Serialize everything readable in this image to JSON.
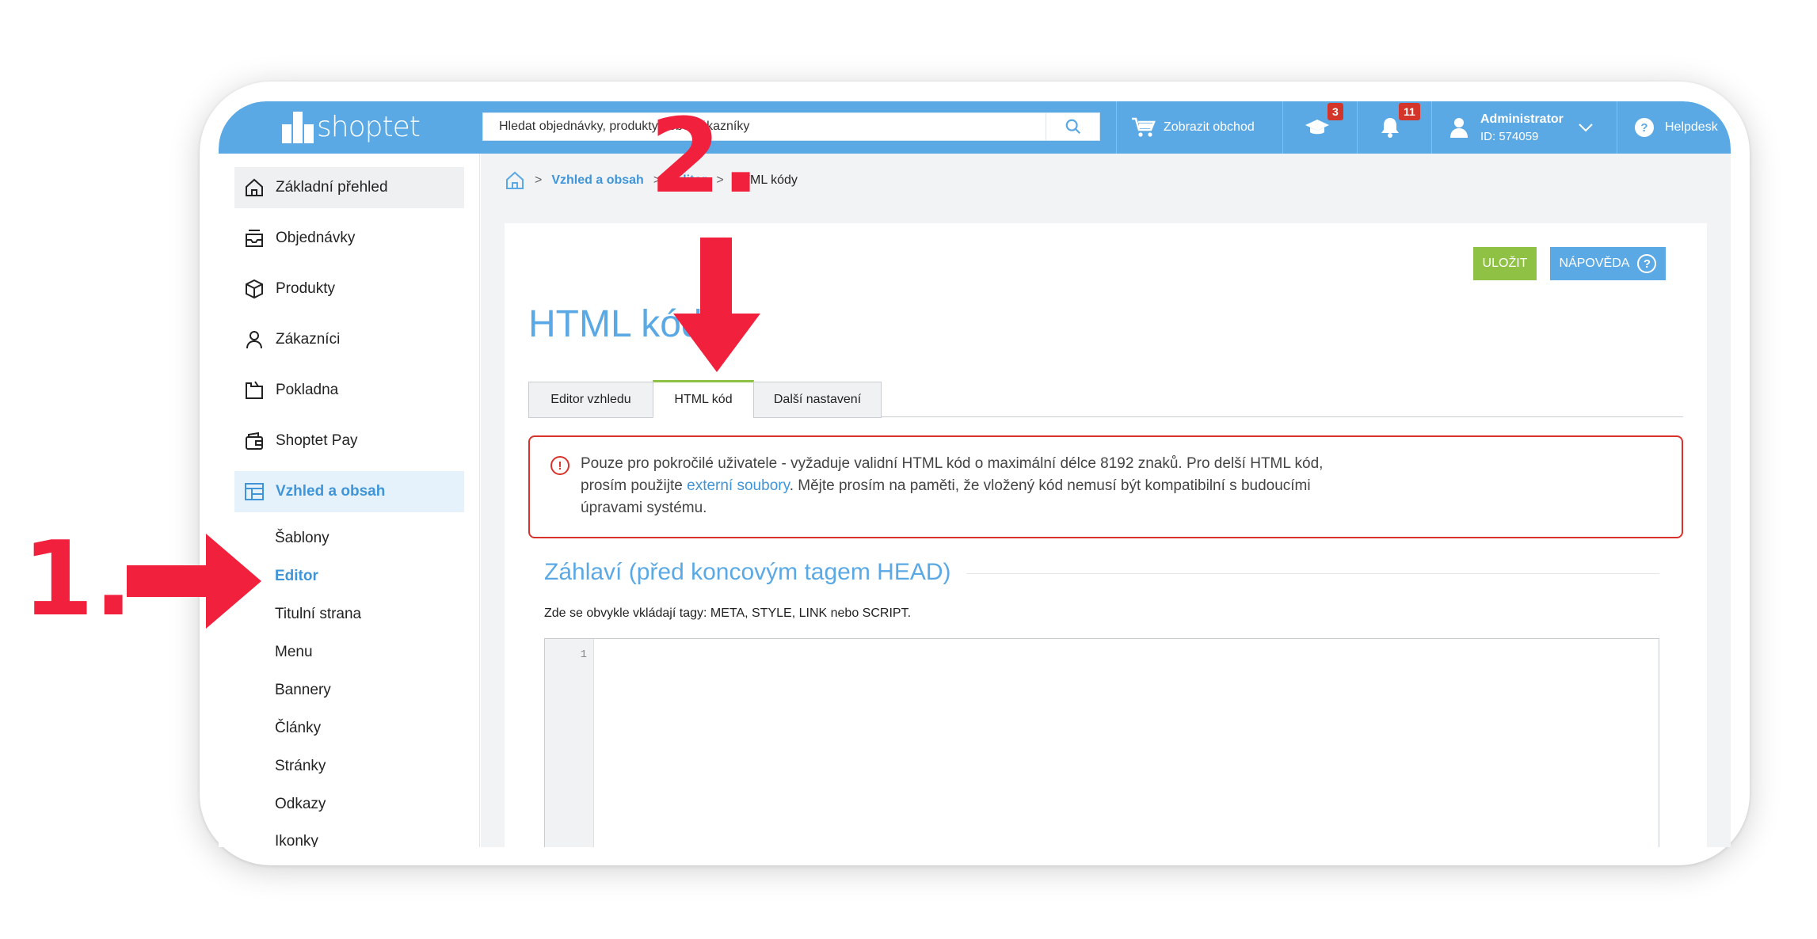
{
  "colors": {
    "brand": "#5ba9e4",
    "active_text": "#3f95d8",
    "save": "#8fc244",
    "alert": "#d9322b",
    "annotation": "#f1213d"
  },
  "header": {
    "logo_text": "shoptet",
    "search_placeholder": "Hledat objednávky, produkty nebo zákazníky",
    "view_store_label": "Zobrazit obchod",
    "academy_badge": "3",
    "notifications_badge": "11",
    "admin_name": "Administrator",
    "admin_id": "ID: 574059",
    "helpdesk_label": "Helpdesk",
    "icons": [
      "cart-icon",
      "graduation-cap-icon",
      "bell-icon",
      "user-icon",
      "chevron-down-icon",
      "help-icon"
    ]
  },
  "sidebar": {
    "items": [
      {
        "label": "Základní přehled",
        "icon": "home-icon"
      },
      {
        "label": "Objednávky",
        "icon": "inbox-icon"
      },
      {
        "label": "Produkty",
        "icon": "box-icon"
      },
      {
        "label": "Zákazníci",
        "icon": "user-icon"
      },
      {
        "label": "Pokladna",
        "icon": "register-icon"
      },
      {
        "label": "Shoptet Pay",
        "icon": "wallet-icon"
      },
      {
        "label": "Vzhled a obsah",
        "icon": "layout-icon"
      }
    ],
    "subitems": [
      "Šablony",
      "Editor",
      "Titulní strana",
      "Menu",
      "Bannery",
      "Články",
      "Stránky",
      "Odkazy",
      "Ikonky"
    ]
  },
  "breadcrumb": {
    "sep": ">",
    "parent": "Vzhled a obsah",
    "middle": "Editor",
    "current": "HTML kódy"
  },
  "page": {
    "save_label": "ULOŽIT",
    "help_label": "NÁPOVĚDA",
    "help_icon": "?",
    "title": "HTML kódy",
    "tabs": [
      "Editor vzhledu",
      "HTML kód",
      "Další nastavení"
    ],
    "alert_icon": "!",
    "alert_before": "Pouze pro pokročilé uživatele - vyžaduje validní HTML kód o maximální délce 8192 znaků. Pro delší HTML kód, prosím použijte ",
    "alert_link": "externí soubory",
    "alert_after": ". Mějte prosím na paměti, že vložený kód nemusí být kompatibilní s budoucími úpravami systému.",
    "section_title": "Záhlaví (před koncovým tagem HEAD)",
    "section_desc": "Zde se obvykle vkládají tagy: META, STYLE, LINK nebo SCRIPT.",
    "editor_line": "1"
  },
  "annotations": {
    "step1": "1.",
    "step2": "2."
  }
}
